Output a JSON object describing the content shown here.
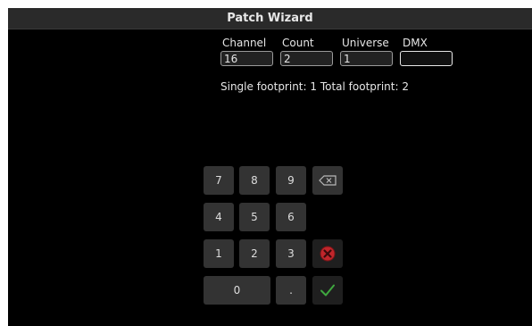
{
  "window": {
    "title": "Patch Wizard"
  },
  "fields": {
    "channel": {
      "label": "Channel",
      "value": "16"
    },
    "count": {
      "label": "Count",
      "value": "2"
    },
    "universe": {
      "label": "Universe",
      "value": "1"
    },
    "dmx": {
      "label": "DMX",
      "value": ""
    }
  },
  "footprint_text": "Single footprint: 1 Total footprint: 2",
  "keypad": {
    "k7": "7",
    "k8": "8",
    "k9": "9",
    "k4": "4",
    "k5": "5",
    "k6": "6",
    "k1": "1",
    "k2": "2",
    "k3": "3",
    "k0": "0",
    "dot": ".",
    "icons": {
      "backspace": "backspace-icon",
      "cancel": "cancel-x-icon",
      "confirm": "checkmark-icon"
    }
  },
  "colors": {
    "cancel": "#c0262b",
    "confirm": "#3fa83f"
  }
}
